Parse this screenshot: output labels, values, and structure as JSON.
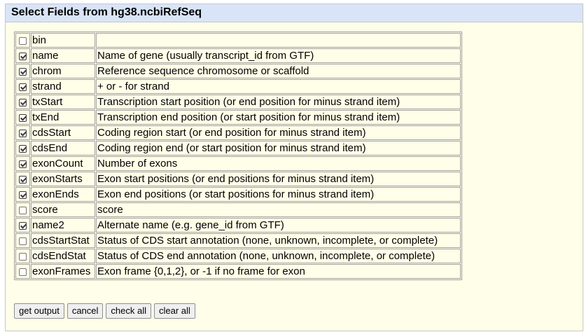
{
  "title": "Select Fields from hg38.ncbiRefSeq",
  "fields": [
    {
      "name": "bin",
      "description": "",
      "checked": false
    },
    {
      "name": "name",
      "description": "Name of gene (usually transcript_id from GTF)",
      "checked": true
    },
    {
      "name": "chrom",
      "description": "Reference sequence chromosome or scaffold",
      "checked": true
    },
    {
      "name": "strand",
      "description": "+ or - for strand",
      "checked": true
    },
    {
      "name": "txStart",
      "description": "Transcription start position (or end position for minus strand item)",
      "checked": true
    },
    {
      "name": "txEnd",
      "description": "Transcription end position (or start position for minus strand item)",
      "checked": true
    },
    {
      "name": "cdsStart",
      "description": "Coding region start (or end position for minus strand item)",
      "checked": true
    },
    {
      "name": "cdsEnd",
      "description": "Coding region end (or start position for minus strand item)",
      "checked": true
    },
    {
      "name": "exonCount",
      "description": "Number of exons",
      "checked": true
    },
    {
      "name": "exonStarts",
      "description": "Exon start positions (or end positions for minus strand item)",
      "checked": true
    },
    {
      "name": "exonEnds",
      "description": "Exon end positions (or start positions for minus strand item)",
      "checked": true
    },
    {
      "name": "score",
      "description": "score",
      "checked": false
    },
    {
      "name": "name2",
      "description": "Alternate name (e.g. gene_id from GTF)",
      "checked": true
    },
    {
      "name": "cdsStartStat",
      "description": "Status of CDS start annotation (none, unknown, incomplete, or complete)",
      "checked": false
    },
    {
      "name": "cdsEndStat",
      "description": "Status of CDS end annotation (none, unknown, incomplete, or complete)",
      "checked": false
    },
    {
      "name": "exonFrames",
      "description": "Exon frame {0,1,2}, or -1 if no frame for exon",
      "checked": false
    }
  ],
  "buttons": {
    "get_output": "get output",
    "cancel": "cancel",
    "check_all": "check all",
    "clear_all": "clear all"
  },
  "colors": {
    "title_bar": "#d9e4f8",
    "panel_background": "#fffee8",
    "border": "#a0a0a0"
  }
}
